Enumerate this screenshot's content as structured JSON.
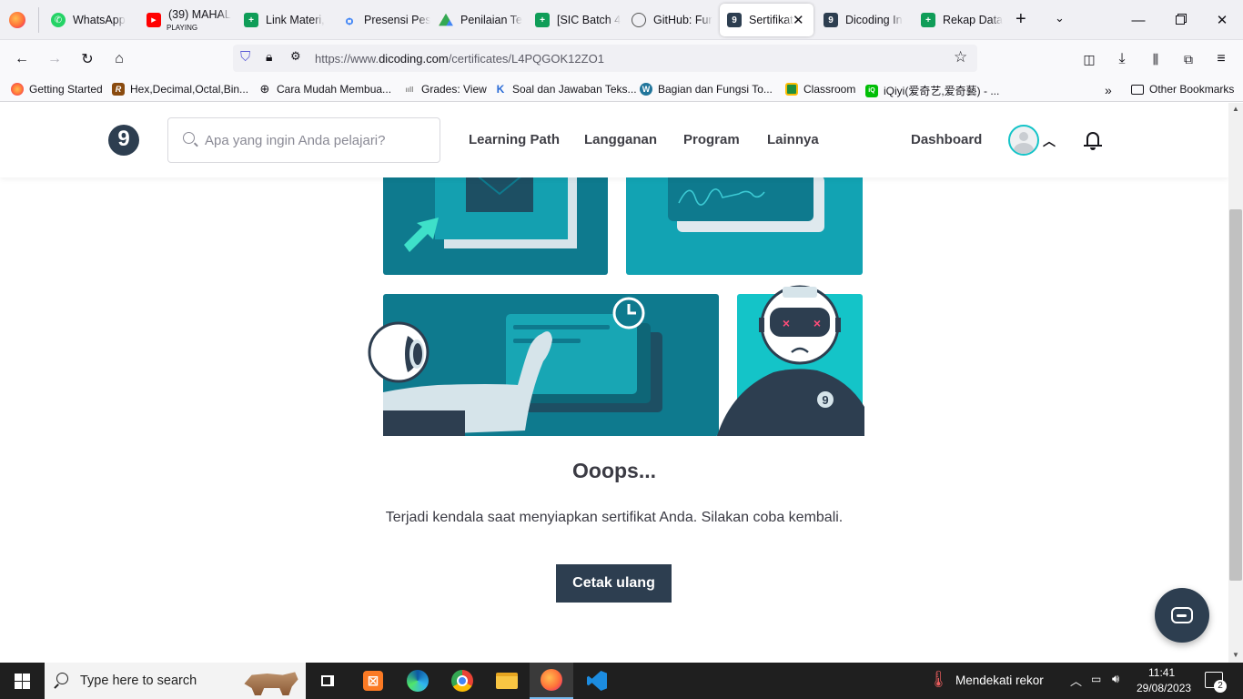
{
  "browser": {
    "tabs": [
      {
        "label": "WhatsApp",
        "icon": "whatsapp-icon"
      },
      {
        "label": "(39) MAHAL",
        "sublabel": "PLAYING",
        "icon": "youtube-icon"
      },
      {
        "label": "Link Materi,",
        "icon": "sheets-icon"
      },
      {
        "label": "Presensi Pes",
        "icon": "form-icon"
      },
      {
        "label": "Penilaian Te",
        "icon": "drive-icon"
      },
      {
        "label": "[SIC Batch 4",
        "icon": "sheets-icon"
      },
      {
        "label": "GitHub: Fur",
        "icon": "github-icon"
      },
      {
        "label": "Sertifikat",
        "icon": "dicoding-icon",
        "active": true
      },
      {
        "label": "Dicoding In",
        "icon": "dicoding-icon"
      },
      {
        "label": "Rekap Data",
        "icon": "sheets-icon"
      }
    ],
    "url_prefix": "https://www.",
    "url_domain": "dicoding.com",
    "url_path": "/certificates/L4PQGOK12ZO1",
    "bookmarks": [
      {
        "label": "Getting Started"
      },
      {
        "label": "Hex,Decimal,Octal,Bin..."
      },
      {
        "label": "Cara Mudah Membua..."
      },
      {
        "label": "Grades: View"
      },
      {
        "label": "Soal dan Jawaban Teks..."
      },
      {
        "label": "Bagian dan Fungsi To..."
      },
      {
        "label": "Classroom"
      },
      {
        "label": "iQiyi(爱奇艺,爱奇藝) - ..."
      }
    ],
    "other_bookmarks": "Other Bookmarks"
  },
  "site": {
    "search_placeholder": "Apa yang ingin Anda pelajari?",
    "menu": [
      "Learning Path",
      "Langganan",
      "Program",
      "Lainnya"
    ],
    "dashboard": "Dashboard",
    "logo_letter": "9",
    "robot_badge": "9"
  },
  "error": {
    "title": "Ooops...",
    "message": "Terjadi kendala saat menyiapkan sertifikat Anda. Silakan coba kembali.",
    "button": "Cetak ulang"
  },
  "taskbar": {
    "search_placeholder": "Type here to search",
    "weather": "Mendekati rekor",
    "time": "11:41",
    "date": "29/08/2023",
    "notifications": "2"
  },
  "colors": {
    "brand_dark": "#2d3e50",
    "teal_dark": "#0e7a8e",
    "teal_mid": "#12a3b3",
    "teal_light": "#14c4c8"
  }
}
